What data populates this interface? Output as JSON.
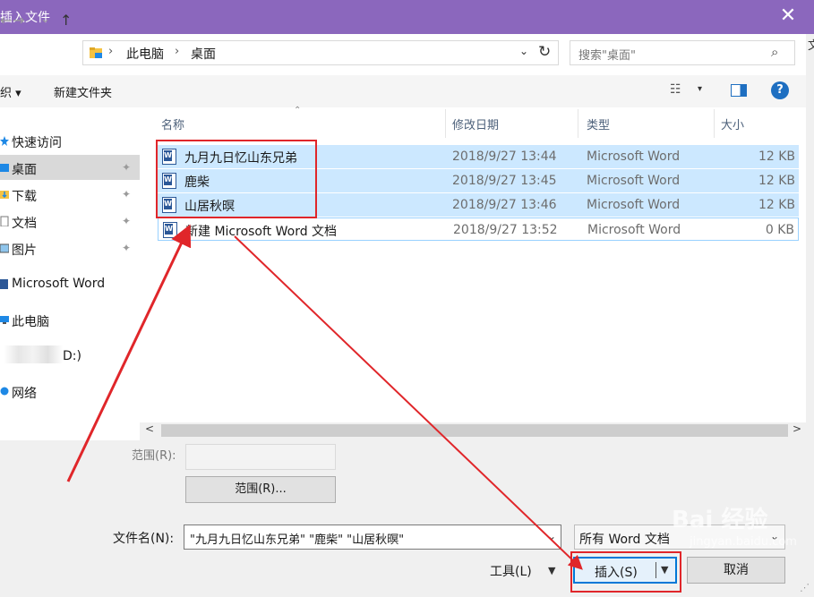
{
  "window": {
    "title": "插入文件",
    "close_glyph": "✕",
    "edge_text": "文"
  },
  "nav": {
    "back": "←",
    "forward": "→",
    "recent": "⌄",
    "up": "↑",
    "breadcrumb": [
      "此电脑",
      "桌面"
    ],
    "address_drop": "⌄",
    "refresh": "↻",
    "search_placeholder": "搜索\"桌面\"",
    "search_icon": "⌕"
  },
  "toolbar": {
    "organize": "织 ▾",
    "new_folder": "新建文件夹",
    "view_icon": "☷",
    "view_drop": "▾",
    "help": "?"
  },
  "sidebar": {
    "items": [
      {
        "label": "快速访问",
        "icon": "star-icon",
        "pin": false
      },
      {
        "label": "桌面",
        "icon": "desktop-folder-icon",
        "pin": true
      },
      {
        "label": "下载",
        "icon": "download-folder-icon",
        "pin": true
      },
      {
        "label": "文档",
        "icon": "documents-icon",
        "pin": true
      },
      {
        "label": "图片",
        "icon": "pictures-icon",
        "pin": true
      },
      {
        "label": "Microsoft Word",
        "icon": "word-icon",
        "pin": false
      },
      {
        "label": "此电脑",
        "icon": "computer-icon",
        "pin": false
      },
      {
        "label": "D:)",
        "icon": "drive-icon",
        "pin": false
      },
      {
        "label": "网络",
        "icon": "network-icon",
        "pin": false
      }
    ],
    "pin_glyph": "📌"
  },
  "columns": {
    "name": "名称",
    "modified": "修改日期",
    "type": "类型",
    "size": "大小",
    "sort_glyph": "⌃"
  },
  "files": [
    {
      "name": "九月九日忆山东兄弟",
      "date": "2018/9/27 13:44",
      "type": "Microsoft Word",
      "size": "12 KB",
      "selected": true
    },
    {
      "name": "鹿柴",
      "date": "2018/9/27 13:45",
      "type": "Microsoft Word",
      "size": "12 KB",
      "selected": true
    },
    {
      "name": "山居秋暝",
      "date": "2018/9/27 13:46",
      "type": "Microsoft Word",
      "size": "12 KB",
      "selected": true
    },
    {
      "name": "新建 Microsoft Word 文档",
      "date": "2018/9/27 13:52",
      "type": "Microsoft Word",
      "size": "0 KB",
      "selected": false
    }
  ],
  "word_icon_letter": "W",
  "scroll": {
    "left": "<",
    "right": ">"
  },
  "bottom": {
    "range_label": "范围(R):",
    "range_button": "范围(R)...",
    "filename_label": "文件名(N):",
    "filename_value": "\"九月九日忆山东兄弟\" \"鹿柴\" \"山居秋暝\"",
    "filename_drop": "⌄",
    "filetype_value": "所有 Word 文档",
    "filetype_drop": "⌄",
    "tools_label": "工具(L)",
    "tools_drop": "▼",
    "insert_label": "插入(S)",
    "insert_drop": "▼",
    "cancel_label": "取消"
  },
  "watermark": {
    "main": "Bai 经验",
    "sub": "jingyan.baidu.com"
  },
  "colors": {
    "titlebar": "#8b67bd",
    "selection": "#cce8ff",
    "annotation": "#e0262a",
    "accent": "#0078d7"
  }
}
